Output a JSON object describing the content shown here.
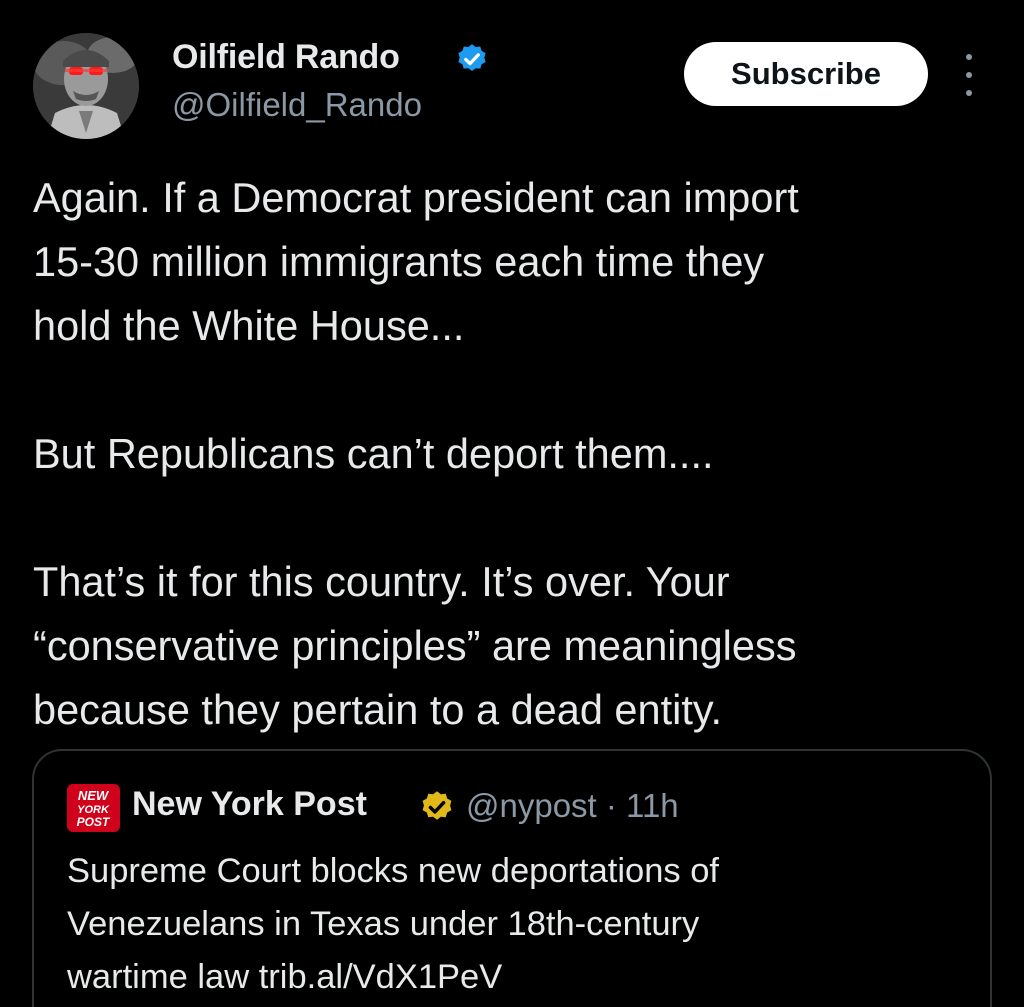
{
  "author": {
    "display_name": "Oilfield Rando",
    "handle": "@Oilfield_Rando",
    "verified_color": "#1d9bf0"
  },
  "actions": {
    "subscribe_label": "Subscribe",
    "more_icon": "more-vertical-icon"
  },
  "tweet": {
    "lines": [
      "Again. If a Democrat president can import",
      "15-30 million immigrants each time they",
      "hold the White House...",
      "But Republicans can’t deport them....",
      "That’s it for this country. It’s over. Your",
      "“conservative principles” are meaningless",
      "because they pertain to a dead entity."
    ]
  },
  "quote": {
    "name": "New York Post",
    "meta": "@nypost · 11h",
    "verified_color": "#e2b719",
    "logo_color": "#d0021b",
    "lines": [
      "Supreme Court blocks new deportations of",
      "Venezuelans in Texas under 18th-century",
      "wartime law trib.al/VdX1PeV"
    ]
  }
}
